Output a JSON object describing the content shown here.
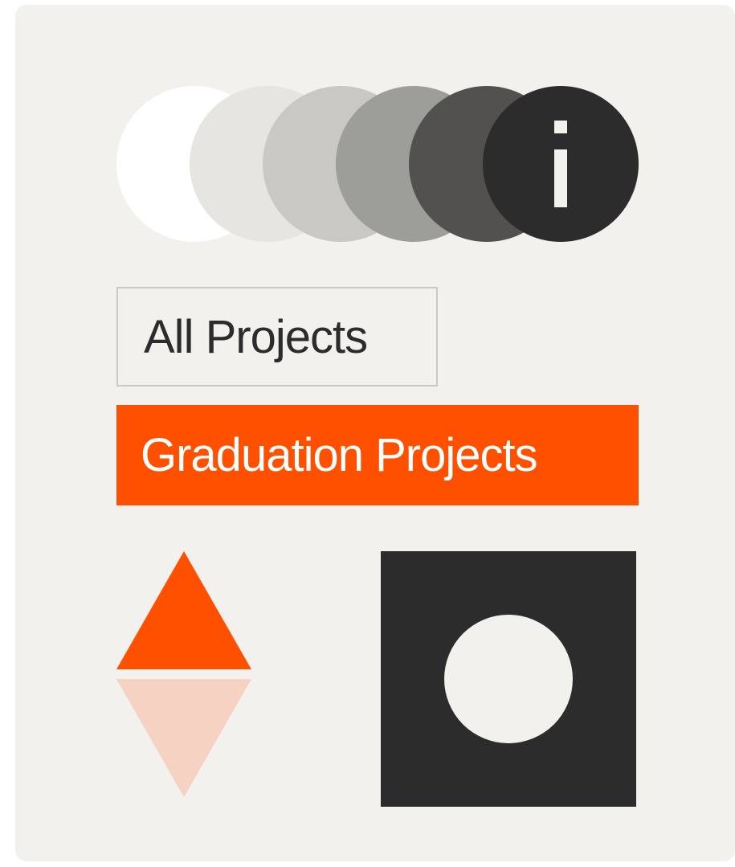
{
  "colors": {
    "panel_background": "#f2f1ee",
    "accent": "#ff5000",
    "accent_light": "#f5d2c1",
    "dark": "#2c2c2c",
    "outline": "#c9c8c3"
  },
  "swatches": [
    {
      "name": "white",
      "color": "#ffffff"
    },
    {
      "name": "light-grey",
      "color": "#e6e5e1"
    },
    {
      "name": "grey",
      "color": "#c9c8c2"
    },
    {
      "name": "mid-grey",
      "color": "#9d9e99"
    },
    {
      "name": "dark-grey",
      "color": "#525150"
    },
    {
      "name": "charcoal",
      "color": "#2c2c2c",
      "icon": "info-icon"
    }
  ],
  "filters": {
    "all_projects_label": "All Projects",
    "graduation_projects_label": "Graduation Projects"
  },
  "icons": {
    "sort": "sort-triangles-icon",
    "square": "square-with-circle-icon"
  }
}
